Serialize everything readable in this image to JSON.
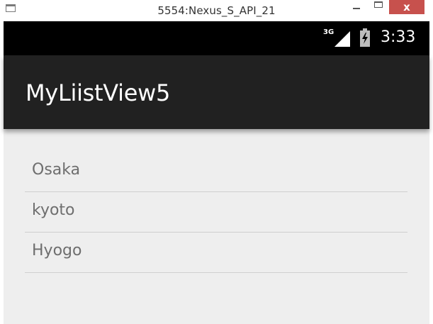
{
  "window": {
    "title": "5554:Nexus_S_API_21",
    "close_glyph": "x"
  },
  "status_bar": {
    "network_type": "3G",
    "signal_icon": "cell-signal-icon",
    "battery_icon": "battery-charging-icon",
    "time": "3:33"
  },
  "action_bar": {
    "title": "MyLiistView5"
  },
  "list": {
    "items": [
      {
        "label": "Osaka"
      },
      {
        "label": "kyoto"
      },
      {
        "label": "Hyogo"
      }
    ]
  },
  "colors": {
    "status_bar_bg": "#000000",
    "action_bar_bg": "#212121",
    "content_bg": "#eeeeee",
    "close_button_bg": "#c7514d",
    "list_text": "#6e6e6e",
    "divider": "#cfcfcf"
  }
}
